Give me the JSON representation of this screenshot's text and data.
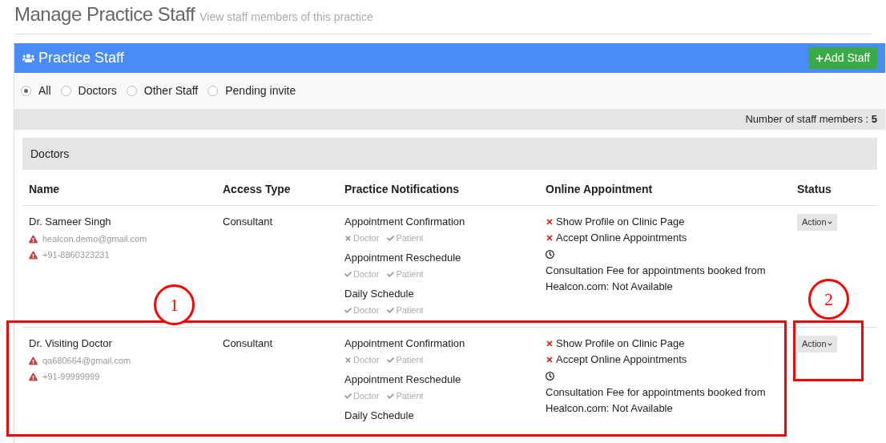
{
  "page": {
    "title": "Manage Practice Staff",
    "subtitle": "View staff members of this practice"
  },
  "panel": {
    "title": "Practice Staff",
    "add_button": "Add Staff"
  },
  "filters": [
    {
      "label": "All",
      "selected": true
    },
    {
      "label": "Doctors",
      "selected": false
    },
    {
      "label": "Other Staff",
      "selected": false
    },
    {
      "label": "Pending invite",
      "selected": false
    }
  ],
  "count": {
    "label": "Number of staff members :",
    "value": "5"
  },
  "group": {
    "title": "Doctors"
  },
  "table": {
    "columns": [
      "Name",
      "Access Type",
      "Practice Notifications",
      "Online Appointment",
      "Status"
    ],
    "rows": [
      {
        "name": "Dr. Sameer Singh",
        "email": "healcon.demo@gmail.com",
        "phone": "+91-8860323231",
        "access": "Consultant",
        "notifications": [
          {
            "title": "Appointment Confirmation",
            "flags": [
              {
                "label": "Doctor",
                "on": false
              },
              {
                "label": "Patient",
                "on": true
              }
            ]
          },
          {
            "title": "Appointment Reschedule",
            "flags": [
              {
                "label": "Doctor",
                "on": true
              },
              {
                "label": "Patient",
                "on": true
              }
            ]
          },
          {
            "title": "Daily Schedule",
            "flags": [
              {
                "label": "Doctor",
                "on": true
              },
              {
                "label": "Patient",
                "on": true
              }
            ]
          }
        ],
        "online": [
          {
            "label": "Show Profile on Clinic Page",
            "on": false
          },
          {
            "label": "Accept Online Appointments",
            "on": false
          }
        ],
        "fee": "Consultation Fee for appointments booked from Healcon.com: Not Available",
        "action": "Action"
      },
      {
        "name": "Dr. Visiting Doctor",
        "email": "qa680664@gmail.com",
        "phone": "+91-99999999",
        "access": "Consultant",
        "notifications": [
          {
            "title": "Appointment Confirmation",
            "flags": [
              {
                "label": "Doctor",
                "on": false
              },
              {
                "label": "Patient",
                "on": true
              }
            ]
          },
          {
            "title": "Appointment Reschedule",
            "flags": [
              {
                "label": "Doctor",
                "on": true
              },
              {
                "label": "Patient",
                "on": true
              }
            ]
          },
          {
            "title": "Daily Schedule"
          }
        ],
        "online": [
          {
            "label": "Show Profile on Clinic Page",
            "on": false
          },
          {
            "label": "Accept Online Appointments",
            "on": false
          }
        ],
        "fee": "Consultation Fee for appointments booked from Healcon.com: Not Available",
        "action": "Action"
      }
    ]
  },
  "annotations": [
    {
      "number": "1"
    },
    {
      "number": "2"
    }
  ]
}
